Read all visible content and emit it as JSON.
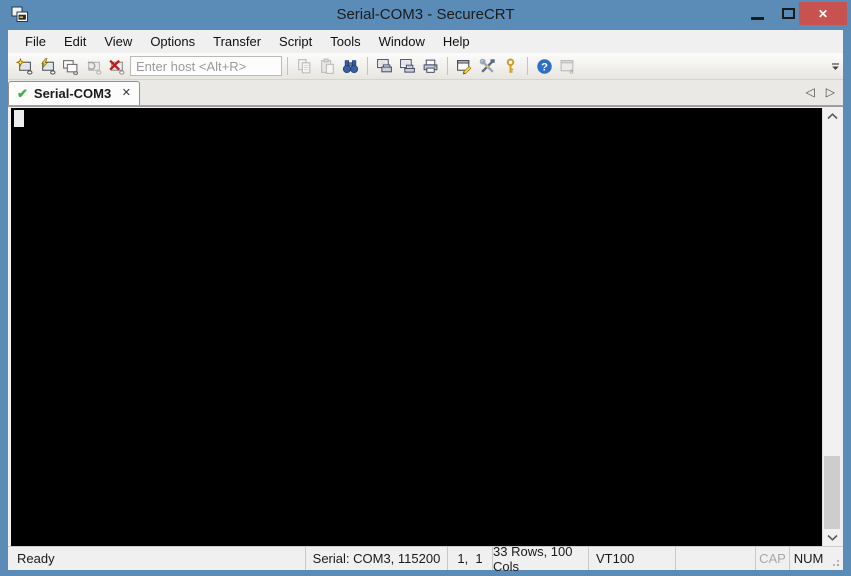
{
  "window": {
    "title": "Serial-COM3 - SecureCRT",
    "close_glyph": "✕"
  },
  "menu": {
    "items": [
      "File",
      "Edit",
      "View",
      "Options",
      "Transfer",
      "Script",
      "Tools",
      "Window",
      "Help"
    ]
  },
  "toolbar": {
    "host_input": {
      "value": "",
      "placeholder": "Enter host <Alt+R>"
    },
    "buttons": [
      {
        "name": "connect",
        "group": 0,
        "enabled": true
      },
      {
        "name": "quick-connect",
        "group": 0,
        "enabled": true
      },
      {
        "name": "connect-in-tab",
        "group": 0,
        "enabled": true
      },
      {
        "name": "reconnect",
        "group": 0,
        "enabled": false
      },
      {
        "name": "disconnect",
        "group": 0,
        "enabled": true
      },
      {
        "name": "copy",
        "group": 1,
        "enabled": false
      },
      {
        "name": "paste",
        "group": 1,
        "enabled": false
      },
      {
        "name": "find",
        "group": 1,
        "enabled": true
      },
      {
        "name": "print",
        "group": 2,
        "enabled": true
      },
      {
        "name": "auto-print",
        "group": 2,
        "enabled": true
      },
      {
        "name": "print-setup",
        "group": 2,
        "enabled": true
      },
      {
        "name": "session-options",
        "group": 3,
        "enabled": true
      },
      {
        "name": "global-options",
        "group": 3,
        "enabled": true
      },
      {
        "name": "key-agent",
        "group": 3,
        "enabled": true
      },
      {
        "name": "help",
        "group": 4,
        "enabled": true
      },
      {
        "name": "launch-securefx",
        "group": 4,
        "enabled": false
      }
    ]
  },
  "tab_bar": {
    "tabs": [
      {
        "label": "Serial-COM3",
        "status_glyph": "✔",
        "close_glyph": "✕",
        "active": true
      }
    ],
    "scroll_left_glyph": "◁",
    "scroll_right_glyph": "▷"
  },
  "terminal": {
    "content": "",
    "cursor_visible": true
  },
  "status_bar": {
    "ready": "Ready",
    "connection": "Serial: COM3, 115200",
    "cursor_position": "1,  1",
    "dimensions": "33 Rows, 100 Cols",
    "emulation": "VT100",
    "caps_indicator": "CAP",
    "num_indicator": "NUM",
    "caps_enabled": false,
    "num_enabled": true
  },
  "colors": {
    "titlebar_blue": "#5b8cb8",
    "close_button_red": "#c85250",
    "terminal_bg": "#000000",
    "chrome_bg": "#f0f0f0",
    "tab_active_bg": "#fcfcfc",
    "cursor": "#ededed",
    "tab_check_green": "#3fae49"
  }
}
